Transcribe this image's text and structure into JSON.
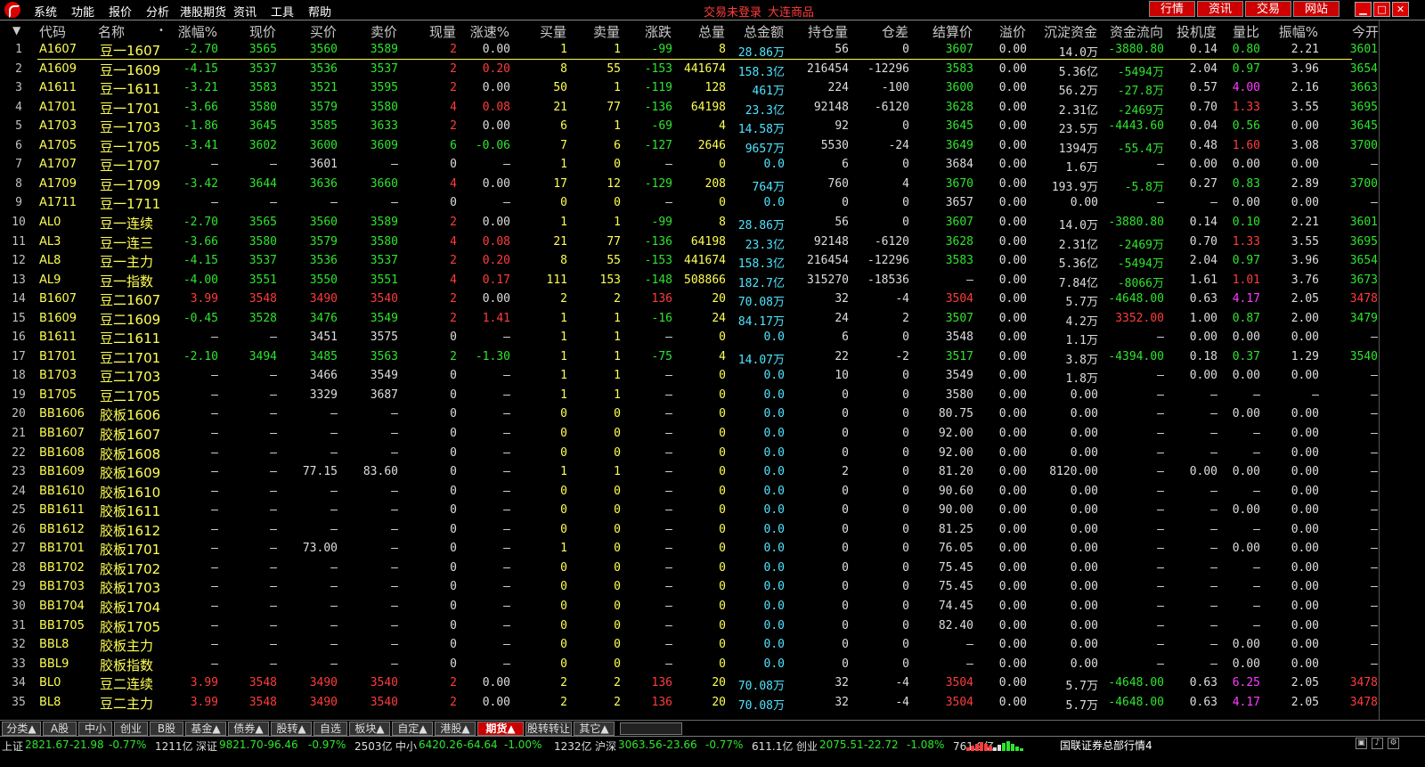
{
  "menu": {
    "items": [
      "系统",
      "功能",
      "报价",
      "分析",
      "港股期货",
      "资讯",
      "工具",
      "帮助"
    ],
    "login_status": "交易未登录",
    "exchange": "大连商品",
    "top_buttons": [
      "行情",
      "资讯",
      "交易",
      "网站"
    ],
    "window_buttons": [
      "▁",
      "□",
      "✕"
    ]
  },
  "headers": [
    "代码",
    "名称",
    "•",
    "涨幅%",
    "现价",
    "买价",
    "卖价",
    "现量",
    "涨速%",
    "买量",
    "卖量",
    "涨跌",
    "总量",
    "总金额",
    "持仓量",
    "仓差",
    "结算价",
    "溢价",
    "沉淀资金",
    "资金流向",
    "投机度",
    "量比",
    "振幅%",
    "今开"
  ],
  "sort_icon": "▼",
  "rows": [
    [
      "1",
      "A1607",
      "豆一1607",
      "-2.70",
      "3565",
      "3560",
      "3589",
      "2",
      "0.00",
      "1",
      "1",
      "-99",
      "8",
      "28.86万",
      "56",
      "0",
      "3607",
      "0.00",
      "14.0万",
      "-3880.80",
      "0.14",
      "0.80",
      "2.21",
      "3601"
    ],
    [
      "2",
      "A1609",
      "豆一1609",
      "-4.15",
      "3537",
      "3536",
      "3537",
      "2",
      "0.20",
      "8",
      "55",
      "-153",
      "441674",
      "158.3亿",
      "216454",
      "-12296",
      "3583",
      "0.00",
      "5.36亿",
      "-5494万",
      "2.04",
      "0.97",
      "3.96",
      "3654"
    ],
    [
      "3",
      "A1611",
      "豆一1611",
      "-3.21",
      "3583",
      "3521",
      "3595",
      "2",
      "0.00",
      "50",
      "1",
      "-119",
      "128",
      "461万",
      "224",
      "-100",
      "3600",
      "0.00",
      "56.2万",
      "-27.8万",
      "0.57",
      "4.00",
      "2.16",
      "3663"
    ],
    [
      "4",
      "A1701",
      "豆一1701",
      "-3.66",
      "3580",
      "3579",
      "3580",
      "4",
      "0.08",
      "21",
      "77",
      "-136",
      "64198",
      "23.3亿",
      "92148",
      "-6120",
      "3628",
      "0.00",
      "2.31亿",
      "-2469万",
      "0.70",
      "1.33",
      "3.55",
      "3695"
    ],
    [
      "5",
      "A1703",
      "豆一1703",
      "-1.86",
      "3645",
      "3585",
      "3633",
      "2",
      "0.00",
      "6",
      "1",
      "-69",
      "4",
      "14.58万",
      "92",
      "0",
      "3645",
      "0.00",
      "23.5万",
      "-4443.60",
      "0.04",
      "0.56",
      "0.00",
      "3645"
    ],
    [
      "6",
      "A1705",
      "豆一1705",
      "-3.41",
      "3602",
      "3600",
      "3609",
      "6",
      "-0.06",
      "7",
      "6",
      "-127",
      "2646",
      "9657万",
      "5530",
      "-24",
      "3649",
      "0.00",
      "1394万",
      "-55.4万",
      "0.48",
      "1.60",
      "3.08",
      "3700"
    ],
    [
      "7",
      "A1707",
      "豆一1707",
      "–",
      "–",
      "3601",
      "–",
      "0",
      "–",
      "1",
      "0",
      "–",
      "0",
      "0.0",
      "6",
      "0",
      "3684",
      "0.00",
      "1.6万",
      "–",
      "0.00",
      "0.00",
      "0.00",
      "–"
    ],
    [
      "8",
      "A1709",
      "豆一1709",
      "-3.42",
      "3644",
      "3636",
      "3660",
      "4",
      "0.00",
      "17",
      "12",
      "-129",
      "208",
      "764万",
      "760",
      "4",
      "3670",
      "0.00",
      "193.9万",
      "-5.8万",
      "0.27",
      "0.83",
      "2.89",
      "3700"
    ],
    [
      "9",
      "A1711",
      "豆一1711",
      "–",
      "–",
      "–",
      "–",
      "0",
      "–",
      "0",
      "0",
      "–",
      "0",
      "0.0",
      "0",
      "0",
      "3657",
      "0.00",
      "0.00",
      "–",
      "–",
      "0.00",
      "0.00",
      "–"
    ],
    [
      "10",
      "AL0",
      "豆一连续",
      "-2.70",
      "3565",
      "3560",
      "3589",
      "2",
      "0.00",
      "1",
      "1",
      "-99",
      "8",
      "28.86万",
      "56",
      "0",
      "3607",
      "0.00",
      "14.0万",
      "-3880.80",
      "0.14",
      "0.10",
      "2.21",
      "3601"
    ],
    [
      "11",
      "AL3",
      "豆一连三",
      "-3.66",
      "3580",
      "3579",
      "3580",
      "4",
      "0.08",
      "21",
      "77",
      "-136",
      "64198",
      "23.3亿",
      "92148",
      "-6120",
      "3628",
      "0.00",
      "2.31亿",
      "-2469万",
      "0.70",
      "1.33",
      "3.55",
      "3695"
    ],
    [
      "12",
      "AL8",
      "豆一主力",
      "-4.15",
      "3537",
      "3536",
      "3537",
      "2",
      "0.20",
      "8",
      "55",
      "-153",
      "441674",
      "158.3亿",
      "216454",
      "-12296",
      "3583",
      "0.00",
      "5.36亿",
      "-5494万",
      "2.04",
      "0.97",
      "3.96",
      "3654"
    ],
    [
      "13",
      "AL9",
      "豆一指数",
      "-4.00",
      "3551",
      "3550",
      "3551",
      "4",
      "0.17",
      "111",
      "153",
      "-148",
      "508866",
      "182.7亿",
      "315270",
      "-18536",
      "–",
      "0.00",
      "7.84亿",
      "-8066万",
      "1.61",
      "1.01",
      "3.76",
      "3673"
    ],
    [
      "14",
      "B1607",
      "豆二1607",
      "3.99",
      "3548",
      "3490",
      "3540",
      "2",
      "0.00",
      "2",
      "2",
      "136",
      "20",
      "70.08万",
      "32",
      "-4",
      "3504",
      "0.00",
      "5.7万",
      "-4648.00",
      "0.63",
      "4.17",
      "2.05",
      "3478"
    ],
    [
      "15",
      "B1609",
      "豆二1609",
      "-0.45",
      "3528",
      "3476",
      "3549",
      "2",
      "1.41",
      "1",
      "1",
      "-16",
      "24",
      "84.17万",
      "24",
      "2",
      "3507",
      "0.00",
      "4.2万",
      "3352.00",
      "1.00",
      "0.87",
      "2.00",
      "3479"
    ],
    [
      "16",
      "B1611",
      "豆二1611",
      "–",
      "–",
      "3451",
      "3575",
      "0",
      "–",
      "1",
      "1",
      "–",
      "0",
      "0.0",
      "6",
      "0",
      "3548",
      "0.00",
      "1.1万",
      "–",
      "0.00",
      "0.00",
      "0.00",
      "–"
    ],
    [
      "17",
      "B1701",
      "豆二1701",
      "-2.10",
      "3494",
      "3485",
      "3563",
      "2",
      "-1.30",
      "1",
      "1",
      "-75",
      "4",
      "14.07万",
      "22",
      "-2",
      "3517",
      "0.00",
      "3.8万",
      "-4394.00",
      "0.18",
      "0.37",
      "1.29",
      "3540"
    ],
    [
      "18",
      "B1703",
      "豆二1703",
      "–",
      "–",
      "3466",
      "3549",
      "0",
      "–",
      "1",
      "1",
      "–",
      "0",
      "0.0",
      "10",
      "0",
      "3549",
      "0.00",
      "1.8万",
      "–",
      "0.00",
      "0.00",
      "0.00",
      "–"
    ],
    [
      "19",
      "B1705",
      "豆二1705",
      "–",
      "–",
      "3329",
      "3687",
      "0",
      "–",
      "1",
      "1",
      "–",
      "0",
      "0.0",
      "0",
      "0",
      "3580",
      "0.00",
      "0.00",
      "–",
      "–",
      "–",
      "–",
      "–"
    ],
    [
      "20",
      "BB1606",
      "胶板1606",
      "–",
      "–",
      "–",
      "–",
      "0",
      "–",
      "0",
      "0",
      "–",
      "0",
      "0.0",
      "0",
      "0",
      "80.75",
      "0.00",
      "0.00",
      "–",
      "–",
      "0.00",
      "0.00",
      "–"
    ],
    [
      "21",
      "BB1607",
      "胶板1607",
      "–",
      "–",
      "–",
      "–",
      "0",
      "–",
      "0",
      "0",
      "–",
      "0",
      "0.0",
      "0",
      "0",
      "92.00",
      "0.00",
      "0.00",
      "–",
      "–",
      "–",
      "0.00",
      "–"
    ],
    [
      "22",
      "BB1608",
      "胶板1608",
      "–",
      "–",
      "–",
      "–",
      "0",
      "–",
      "0",
      "0",
      "–",
      "0",
      "0.0",
      "0",
      "0",
      "92.00",
      "0.00",
      "0.00",
      "–",
      "–",
      "–",
      "0.00",
      "–"
    ],
    [
      "23",
      "BB1609",
      "胶板1609",
      "–",
      "–",
      "77.15",
      "83.60",
      "0",
      "–",
      "1",
      "1",
      "–",
      "0",
      "0.0",
      "2",
      "0",
      "81.20",
      "0.00",
      "8120.00",
      "–",
      "0.00",
      "0.00",
      "0.00",
      "–"
    ],
    [
      "24",
      "BB1610",
      "胶板1610",
      "–",
      "–",
      "–",
      "–",
      "0",
      "–",
      "0",
      "0",
      "–",
      "0",
      "0.0",
      "0",
      "0",
      "90.60",
      "0.00",
      "0.00",
      "–",
      "–",
      "–",
      "0.00",
      "–"
    ],
    [
      "25",
      "BB1611",
      "胶板1611",
      "–",
      "–",
      "–",
      "–",
      "0",
      "–",
      "0",
      "0",
      "–",
      "0",
      "0.0",
      "0",
      "0",
      "90.00",
      "0.00",
      "0.00",
      "–",
      "–",
      "0.00",
      "0.00",
      "–"
    ],
    [
      "26",
      "BB1612",
      "胶板1612",
      "–",
      "–",
      "–",
      "–",
      "0",
      "–",
      "0",
      "0",
      "–",
      "0",
      "0.0",
      "0",
      "0",
      "81.25",
      "0.00",
      "0.00",
      "–",
      "–",
      "–",
      "0.00",
      "–"
    ],
    [
      "27",
      "BB1701",
      "胶板1701",
      "–",
      "–",
      "73.00",
      "–",
      "0",
      "–",
      "1",
      "0",
      "–",
      "0",
      "0.0",
      "0",
      "0",
      "76.05",
      "0.00",
      "0.00",
      "–",
      "–",
      "0.00",
      "0.00",
      "–"
    ],
    [
      "28",
      "BB1702",
      "胶板1702",
      "–",
      "–",
      "–",
      "–",
      "0",
      "–",
      "0",
      "0",
      "–",
      "0",
      "0.0",
      "0",
      "0",
      "75.45",
      "0.00",
      "0.00",
      "–",
      "–",
      "–",
      "0.00",
      "–"
    ],
    [
      "29",
      "BB1703",
      "胶板1703",
      "–",
      "–",
      "–",
      "–",
      "0",
      "–",
      "0",
      "0",
      "–",
      "0",
      "0.0",
      "0",
      "0",
      "75.45",
      "0.00",
      "0.00",
      "–",
      "–",
      "–",
      "0.00",
      "–"
    ],
    [
      "30",
      "BB1704",
      "胶板1704",
      "–",
      "–",
      "–",
      "–",
      "0",
      "–",
      "0",
      "0",
      "–",
      "0",
      "0.0",
      "0",
      "0",
      "74.45",
      "0.00",
      "0.00",
      "–",
      "–",
      "–",
      "0.00",
      "–"
    ],
    [
      "31",
      "BB1705",
      "胶板1705",
      "–",
      "–",
      "–",
      "–",
      "0",
      "–",
      "0",
      "0",
      "–",
      "0",
      "0.0",
      "0",
      "0",
      "82.40",
      "0.00",
      "0.00",
      "–",
      "–",
      "–",
      "0.00",
      "–"
    ],
    [
      "32",
      "BBL8",
      "胶板主力",
      "–",
      "–",
      "–",
      "–",
      "0",
      "–",
      "0",
      "0",
      "–",
      "0",
      "0.0",
      "0",
      "0",
      "–",
      "0.00",
      "0.00",
      "–",
      "–",
      "0.00",
      "0.00",
      "–"
    ],
    [
      "33",
      "BBL9",
      "胶板指数",
      "–",
      "–",
      "–",
      "–",
      "0",
      "–",
      "0",
      "0",
      "–",
      "0",
      "0.0",
      "0",
      "0",
      "–",
      "0.00",
      "0.00",
      "–",
      "–",
      "0.00",
      "0.00",
      "–"
    ],
    [
      "34",
      "BL0",
      "豆二连续",
      "3.99",
      "3548",
      "3490",
      "3540",
      "2",
      "0.00",
      "2",
      "2",
      "136",
      "20",
      "70.08万",
      "32",
      "-4",
      "3504",
      "0.00",
      "5.7万",
      "-4648.00",
      "0.63",
      "6.25",
      "2.05",
      "3478"
    ],
    [
      "35",
      "BL8",
      "豆二主力",
      "3.99",
      "3548",
      "3490",
      "3540",
      "2",
      "0.00",
      "2",
      "2",
      "136",
      "20",
      "70.08万",
      "32",
      "-4",
      "3504",
      "0.00",
      "5.7万",
      "-4648.00",
      "0.63",
      "4.17",
      "2.05",
      "3478"
    ]
  ],
  "tabs": [
    {
      "label": "分类▲",
      "active": false
    },
    {
      "label": "A股",
      "active": false
    },
    {
      "label": "中小",
      "active": false
    },
    {
      "label": "创业",
      "active": false
    },
    {
      "label": "B股",
      "active": false
    },
    {
      "label": "基金▲",
      "active": false
    },
    {
      "label": "债券▲",
      "active": false
    },
    {
      "label": "股转▲",
      "active": false
    },
    {
      "label": "自选",
      "active": false
    },
    {
      "label": "板块▲",
      "active": false
    },
    {
      "label": "自定▲",
      "active": false
    },
    {
      "label": "港股▲",
      "active": false
    },
    {
      "label": "期货▲",
      "active": true
    },
    {
      "label": "股转转让",
      "active": false
    },
    {
      "label": "其它▲",
      "active": false
    }
  ],
  "indices": [
    {
      "name": "上证",
      "value": "2821.67",
      "change": "-21.98",
      "pct": "-0.77%",
      "amount": "1211亿"
    },
    {
      "name": "深证",
      "value": "9821.70",
      "change": "-96.46",
      "pct": "-0.97%",
      "amount": "2503亿"
    },
    {
      "name": "中小",
      "value": "6420.26",
      "change": "-64.64",
      "pct": "-1.00%",
      "amount": "1232亿"
    },
    {
      "name": "沪深",
      "value": "3063.56",
      "change": "-23.66",
      "pct": "-0.77%",
      "amount": "611.1亿"
    },
    {
      "name": "创业",
      "value": "2075.51",
      "change": "-22.72",
      "pct": "-1.08%",
      "amount": "761.9亿"
    }
  ],
  "broker": "国联证券总部行情4",
  "colors": {
    "up": "#ff3c3c",
    "down": "#2ee52e",
    "flat": "#dddddd",
    "code": "#ffff54",
    "amount": "#4fe4ff",
    "accent": "#cc0000"
  }
}
